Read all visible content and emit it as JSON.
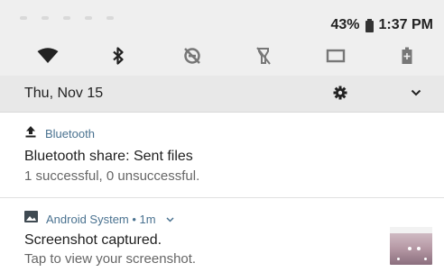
{
  "status_bar": {
    "battery": "43%",
    "time": "1:37 PM"
  },
  "quick_settings": {
    "items": [
      {
        "icon": "wifi-icon"
      },
      {
        "icon": "bluetooth-icon"
      },
      {
        "icon": "do-not-disturb-off-icon"
      },
      {
        "icon": "flashlight-off-icon"
      },
      {
        "icon": "cast-icon"
      },
      {
        "icon": "battery-saver-icon"
      }
    ]
  },
  "header": {
    "date": "Thu, Nov 15",
    "settings_icon": "gear-icon",
    "expand_icon": "chevron-down-icon"
  },
  "notifications": [
    {
      "app": "Bluetooth",
      "icon": "upload-arrow-icon",
      "title": "Bluetooth share: Sent files",
      "text": "1 successful, 0 unsuccessful."
    },
    {
      "app": "Android System • 1m",
      "icon": "image-icon",
      "title": "Screenshot captured.",
      "text": "Tap to view your screenshot."
    }
  ],
  "colors": {
    "panel_bg": "#efefef",
    "date_row_bg": "#e8e8e8",
    "card_bg": "#ffffff",
    "app_name": "#4a7290",
    "secondary_text": "#666666"
  }
}
